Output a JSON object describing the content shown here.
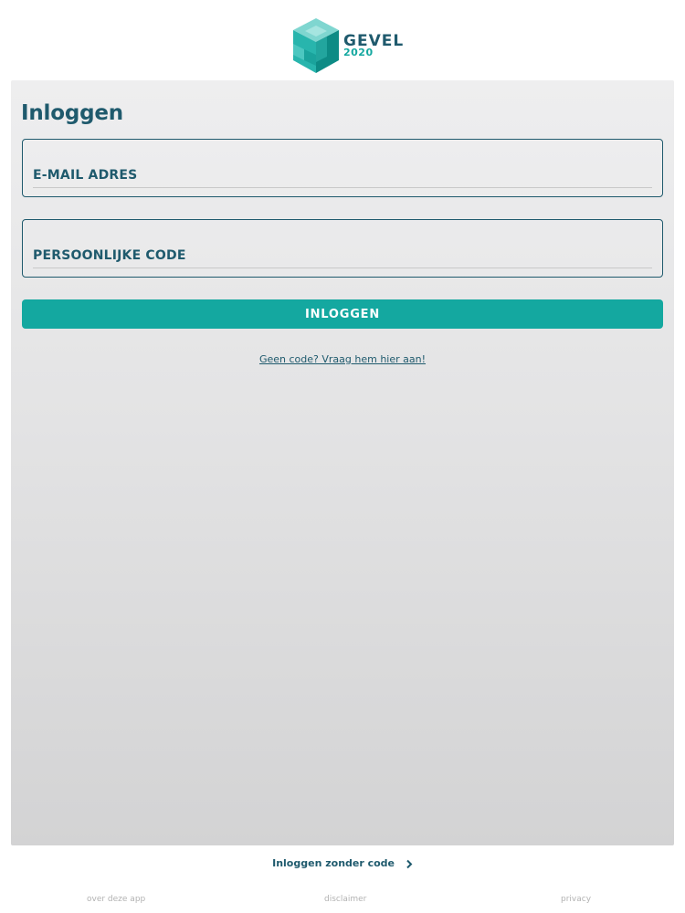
{
  "brand": {
    "name": "GEVEL",
    "year": "2020",
    "icon": "stacked-cube-logo",
    "colors": {
      "navy": "#1f5a6d",
      "teal": "#14a8a0",
      "teal_light": "#4cc7c0",
      "teal_dark": "#0d8b85"
    }
  },
  "login": {
    "title": "Inloggen",
    "email_placeholder": "E-MAIL ADRES",
    "code_placeholder": "PERSOONLIJKE CODE",
    "submit_label": "INLOGGEN",
    "no_code_link": "Geen code? Vraag hem hier aan!"
  },
  "alt_login": {
    "label": "Inloggen zonder code",
    "icon": "chevron-right-icon"
  },
  "footer": {
    "about": "over deze app",
    "disclaimer": "disclaimer",
    "privacy": "privacy"
  }
}
